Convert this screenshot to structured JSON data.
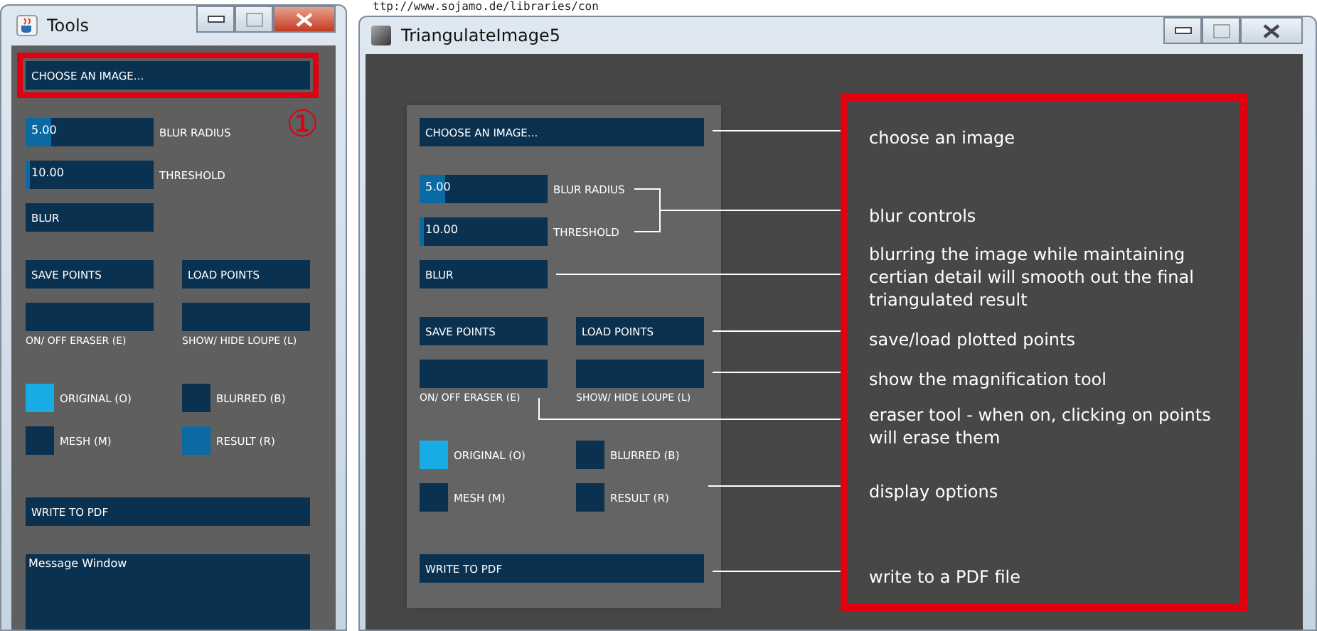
{
  "background_text": "ttp://www.sojamo.de/libraries/con",
  "windows": [
    {
      "kind": "tools",
      "title": "Tools",
      "step_mark": "①",
      "panel": {
        "choose_button": {
          "label": "CHOOSE AN IMAGE...",
          "highlighted": true
        },
        "sliders": [
          {
            "value": "5.00",
            "label": "BLUR RADIUS",
            "level": 0.2
          },
          {
            "value": "10.00",
            "label": "THRESHOLD",
            "level": 0.03
          }
        ],
        "blur_button": "BLUR",
        "save_button": "SAVE POINTS",
        "load_button": "LOAD POINTS",
        "toggles": [
          {
            "label": "ON/ OFF ERASER (E)"
          },
          {
            "label": "SHOW/ HIDE LOUPE (L)"
          }
        ],
        "display_options": [
          {
            "label": "ORIGINAL (O)",
            "on": true,
            "hover": false
          },
          {
            "label": "BLURRED (B)",
            "on": false,
            "hover": false
          },
          {
            "label": "MESH (M)",
            "on": false,
            "hover": false
          },
          {
            "label": "RESULT (R)",
            "on": false,
            "hover": true
          }
        ],
        "write_button": "WRITE TO PDF",
        "message_window": "Message Window"
      }
    },
    {
      "kind": "main",
      "title": "TriangulateImage5",
      "panel": {
        "choose_button": {
          "label": "CHOOSE AN IMAGE...",
          "highlighted": false
        },
        "sliders": [
          {
            "value": "5.00",
            "label": "BLUR RADIUS",
            "level": 0.2
          },
          {
            "value": "10.00",
            "label": "THRESHOLD",
            "level": 0.03
          }
        ],
        "blur_button": "BLUR",
        "save_button": "SAVE POINTS",
        "load_button": "LOAD POINTS",
        "toggles": [
          {
            "label": "ON/ OFF ERASER (E)"
          },
          {
            "label": "SHOW/ HIDE LOUPE (L)"
          }
        ],
        "display_options": [
          {
            "label": "ORIGINAL (O)",
            "on": true,
            "hover": false
          },
          {
            "label": "BLURRED (B)",
            "on": false,
            "hover": false
          },
          {
            "label": "MESH (M)",
            "on": false,
            "hover": false
          },
          {
            "label": "RESULT (R)",
            "on": false,
            "hover": false
          }
        ],
        "write_button": "WRITE TO PDF"
      },
      "notes": [
        "choose an image",
        "blur controls",
        "blurring the image while maintaining certian detail will smooth out the final triangulated result",
        "save/load plotted points",
        "show the magnification tool",
        "eraser tool - when on, clicking on points will erase them",
        "display options",
        "write to a PDF file"
      ]
    }
  ]
}
